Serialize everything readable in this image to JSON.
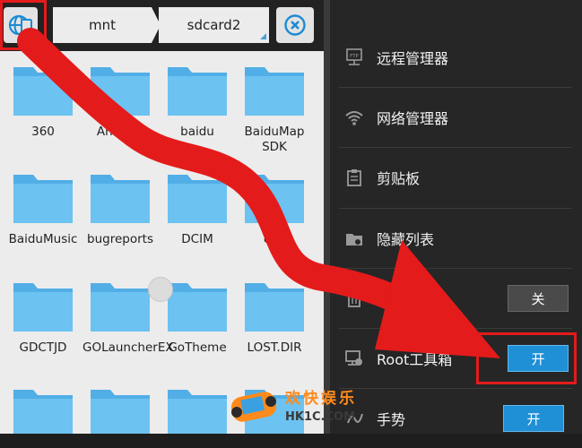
{
  "breadcrumb": {
    "items": [
      "mnt",
      "sdcard2"
    ]
  },
  "icons": {
    "nav": "globe-tablet-icon",
    "close": "close-circle-icon",
    "folder": "folder-icon"
  },
  "colors": {
    "folder": "#5fb7ea",
    "accent": "#1f8fd6",
    "highlight": "#e41b1b"
  },
  "folders": [
    {
      "name": "360"
    },
    {
      "name": "Android"
    },
    {
      "name": "baidu"
    },
    {
      "name": "BaiduMap SDK"
    },
    {
      "name": "BaiduMusic"
    },
    {
      "name": "bugreports"
    },
    {
      "name": "DCIM"
    },
    {
      "name": "ecp"
    },
    {
      "name": "GDCTJD"
    },
    {
      "name": "GOLauncherEX"
    },
    {
      "name": "GoTheme"
    },
    {
      "name": "LOST.DIR"
    },
    {
      "name": ""
    },
    {
      "name": ""
    },
    {
      "name": ""
    },
    {
      "name": ""
    }
  ],
  "menu": {
    "items": [
      {
        "label": "远程管理器",
        "icon": "ftp-icon"
      },
      {
        "label": "网络管理器",
        "icon": "wifi-icon"
      },
      {
        "label": "剪贴板",
        "icon": "clipboard-icon"
      },
      {
        "label": "隐藏列表",
        "icon": "hidden-folder-icon"
      },
      {
        "label": "",
        "icon": "trash-icon",
        "toggle": "关"
      },
      {
        "label": "Root工具箱",
        "icon": "root-tools-icon",
        "toggle": "开"
      },
      {
        "label": "手势",
        "icon": "gesture-icon",
        "toggle": "开"
      }
    ]
  },
  "watermark": {
    "title": "欢快娱乐",
    "site": "HK1C.COM"
  }
}
